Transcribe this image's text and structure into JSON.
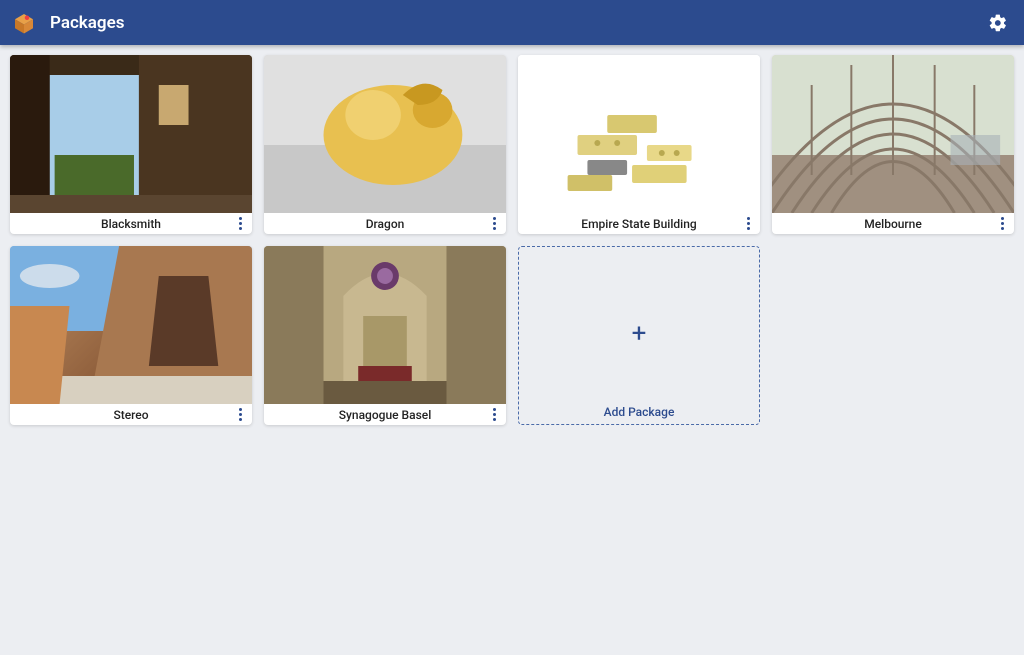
{
  "header": {
    "title": "Packages"
  },
  "packages": [
    {
      "label": "Blacksmith",
      "class": "blacksmith"
    },
    {
      "label": "Dragon",
      "class": "dragon"
    },
    {
      "label": "Empire State Building",
      "class": "empire"
    },
    {
      "label": "Melbourne",
      "class": "melbourne"
    },
    {
      "label": "Stereo",
      "class": "stereo"
    },
    {
      "label": "Synagogue Basel",
      "class": "synagogue"
    }
  ],
  "add_package_label": "Add Package",
  "colors": {
    "header_bg": "#2c4b8e",
    "accent": "#2c4b8e",
    "body_bg": "#eceef2"
  }
}
